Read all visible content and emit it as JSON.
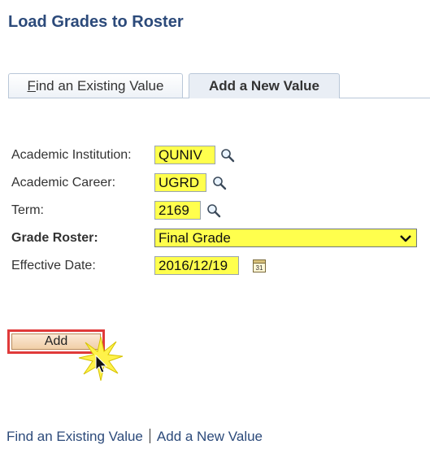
{
  "page": {
    "title": "Load Grades to Roster"
  },
  "tabs": [
    {
      "label_prefix": "",
      "label_underlined": "F",
      "label_rest": "ind an Existing Value"
    },
    {
      "label": "Add a New Value"
    }
  ],
  "form": {
    "academic_institution": {
      "label": "Academic Institution:",
      "value": "QUNIV"
    },
    "academic_career": {
      "label": "Academic Career:",
      "value": "UGRD"
    },
    "term": {
      "label": "Term:",
      "value": "2169"
    },
    "grade_roster": {
      "label": "Grade Roster:",
      "value": "Final Grade"
    },
    "effective_date": {
      "label": "Effective Date:",
      "value": "2016/12/19",
      "calendar_glyph": "31"
    }
  },
  "add_button": {
    "label": "Add"
  },
  "bottom_links": {
    "find": "Find an Existing Value",
    "add": "Add a New Value"
  },
  "colors": {
    "highlight": "#ffff4d",
    "title": "#2c4a7a",
    "add_outline": "#e03a3a"
  },
  "icons": [
    "search-icon",
    "chevron-down-icon",
    "calendar-icon",
    "mouse-cursor-icon"
  ]
}
